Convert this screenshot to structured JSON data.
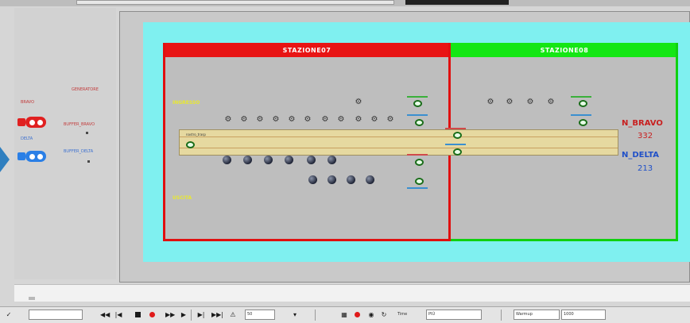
{
  "station_left": "STAZIONE07",
  "station_right": "STAZIONE08",
  "sources": {
    "bravo_label": "BRAVO",
    "delta_label": "DELTA",
    "bravo_color": "#e02020",
    "delta_color": "#2a7fe6"
  },
  "buffers": {
    "bravo": "BUFFER_BRAVO",
    "delta": "BUFFER_DELTA",
    "generator": "GENERATORE"
  },
  "yellow_labels": [
    "INGRESSO",
    "USCITA"
  ],
  "conveyor_label": "nastro_trasp",
  "counters": {
    "bravo_name": "N_BRAVO",
    "bravo_value": "332",
    "delta_name": "N_DELTA",
    "delta_value": "213"
  },
  "toolbar": {
    "speed_field": "50",
    "mode_field": "PIÙ",
    "warmup_label": "Warmup",
    "warmup_value": "1000",
    "time_label": "Time",
    "step_field": ""
  }
}
